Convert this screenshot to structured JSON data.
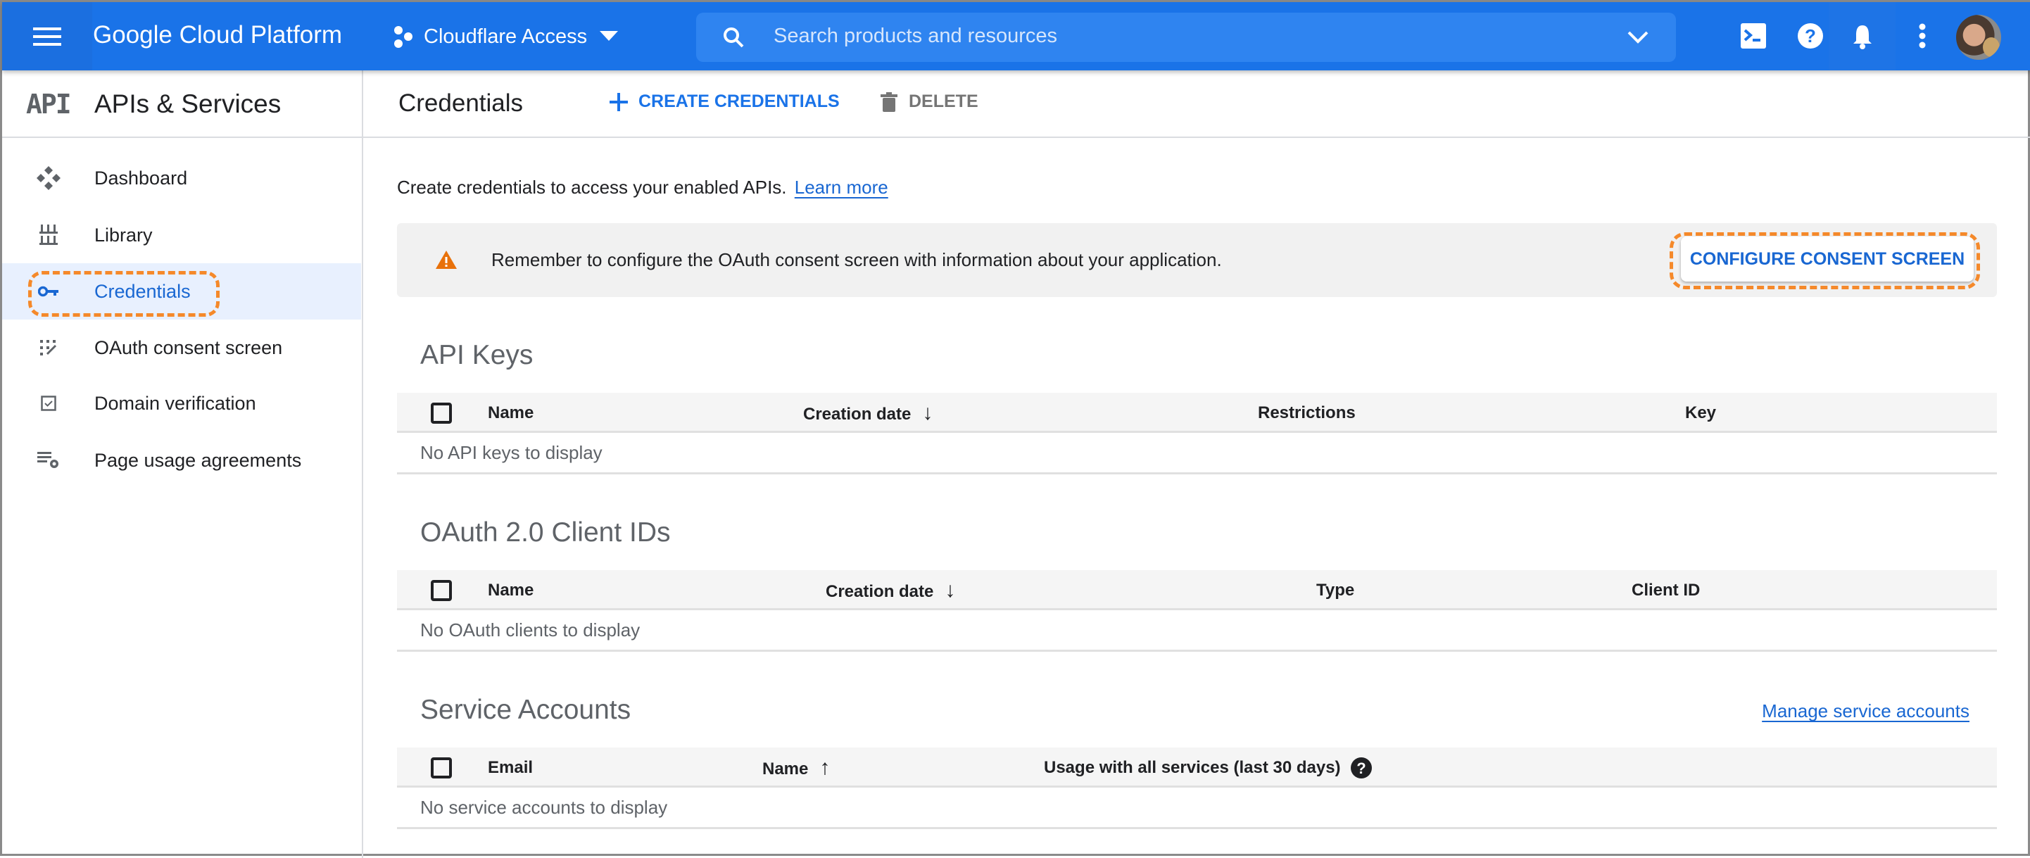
{
  "topbar": {
    "brand": "Google Cloud Platform",
    "project": "Cloudflare Access",
    "search_placeholder": "Search products and resources",
    "icons": [
      "menu-icon",
      "project-icon",
      "caret-down-icon",
      "search-icon",
      "chevron-down-icon",
      "terminal-icon",
      "help-icon",
      "bell-icon",
      "more-vert-icon",
      "avatar"
    ],
    "color": "#1a73e8"
  },
  "sidebar": {
    "logo": "API",
    "title": "APIs & Services",
    "items": [
      {
        "label": "Dashboard",
        "icon": "dashboard-icon"
      },
      {
        "label": "Library",
        "icon": "library-icon"
      },
      {
        "label": "Credentials",
        "icon": "key-icon",
        "selected": true
      },
      {
        "label": "OAuth consent screen",
        "icon": "consent-icon"
      },
      {
        "label": "Domain verification",
        "icon": "checkbox-icon"
      },
      {
        "label": "Page usage agreements",
        "icon": "settings-list-icon"
      }
    ]
  },
  "header": {
    "title": "Credentials",
    "create_label": "CREATE CREDENTIALS",
    "delete_label": "DELETE"
  },
  "main": {
    "intro": "Create credentials to access your enabled APIs.",
    "learn_more": "Learn more",
    "banner_text": "Remember to configure the OAuth consent screen with information about your application.",
    "configure_button": "CONFIGURE CONSENT SCREEN",
    "api_keys": {
      "title": "API Keys",
      "columns": [
        "Name",
        "Creation date",
        "Restrictions",
        "Key"
      ],
      "empty": "No API keys to display"
    },
    "oauth": {
      "title": "OAuth 2.0 Client IDs",
      "columns": [
        "Name",
        "Creation date",
        "Type",
        "Client ID"
      ],
      "empty": "No OAuth clients to display"
    },
    "service_accounts": {
      "title": "Service Accounts",
      "manage_link": "Manage service accounts",
      "columns": [
        "Email",
        "Name",
        "Usage with all services (last 30 days)"
      ],
      "empty": "No service accounts to display"
    }
  },
  "colors": {
    "accent": "#1a73e8",
    "link": "#1967d2",
    "highlight": "#f5892a",
    "warning": "#e8710a"
  }
}
